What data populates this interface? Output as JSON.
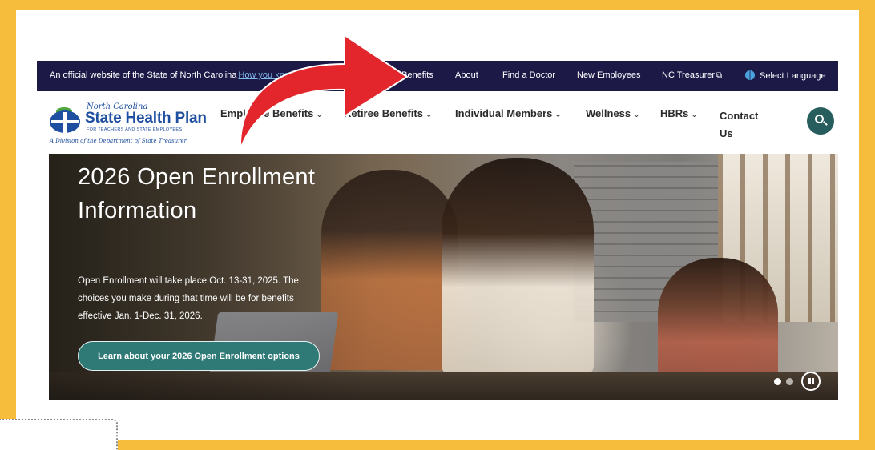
{
  "utility_bar": {
    "official_text": "An official website of the State of North Carolina",
    "how_you_know": "How you know",
    "links": [
      "eBenefits",
      "About",
      "Find a Doctor",
      "New Employees",
      "NC Treasurer"
    ],
    "language": "Select Language"
  },
  "logo": {
    "state": "North Carolina",
    "name": "State Health Plan",
    "tagline": "FOR TEACHERS AND STATE EMPLOYEES",
    "division": "A Division of the Department of State Treasurer"
  },
  "nav": {
    "employee": "Employee Benefits",
    "retiree": "Retiree Benefits",
    "individual": "Individual Members",
    "wellness": "Wellness",
    "hbrs": "HBRs",
    "contact": "Contact Us",
    "chevron": "⌄"
  },
  "hero": {
    "title": "2026 Open Enrollment Information",
    "description": "Open Enrollment will take place Oct. 13-31, 2025. The choices you make during that time will be for benefits effective Jan. 1-Dec. 31, 2026.",
    "cta": "Learn about your 2026 Open Enrollment options"
  },
  "colors": {
    "frame": "#f6bc3c",
    "utility_bar": "#1c1947",
    "accent_teal": "#2f7a77",
    "arrow": "#e3262b"
  }
}
